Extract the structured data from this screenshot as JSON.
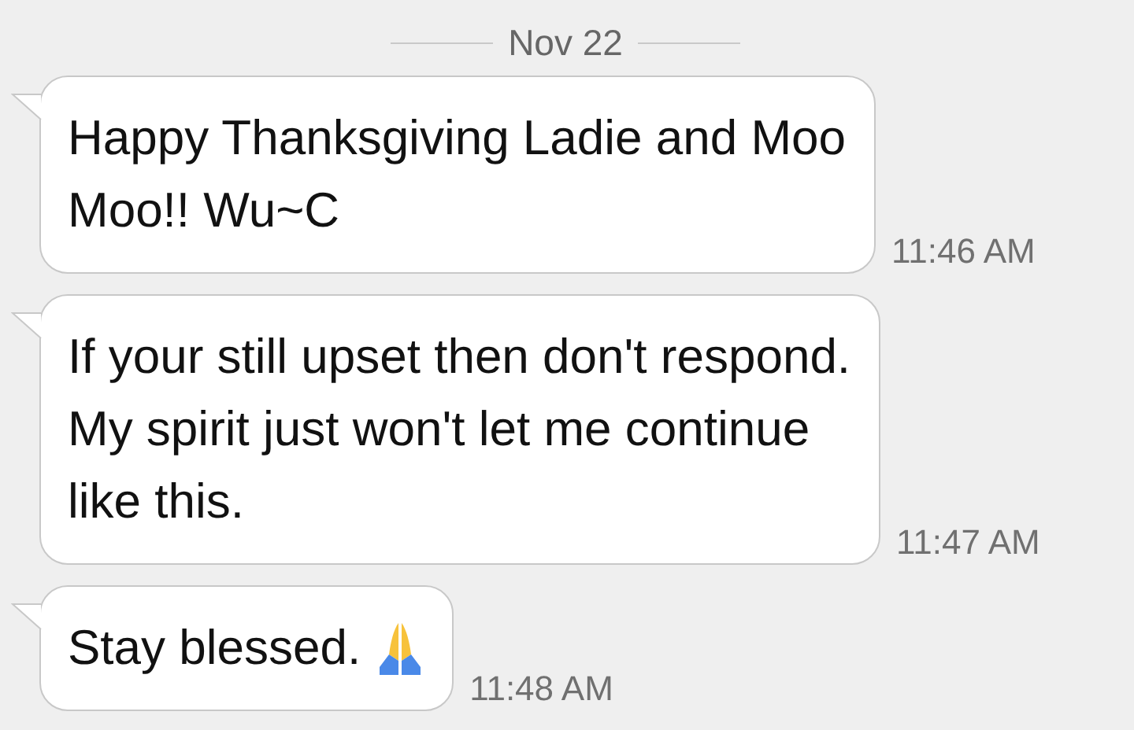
{
  "date_divider": "Nov 22",
  "messages": [
    {
      "text": "Happy Thanksgiving Ladie and Moo\nMoo!! Wu~C",
      "time": "11:46 AM",
      "trailing_icon": false
    },
    {
      "text": "If your still upset then don't respond.\nMy spirit just won't let me continue\nlike this.",
      "time": "11:47 AM",
      "trailing_icon": false
    },
    {
      "text": "Stay blessed.",
      "time": "11:48 AM",
      "trailing_icon": true
    }
  ]
}
